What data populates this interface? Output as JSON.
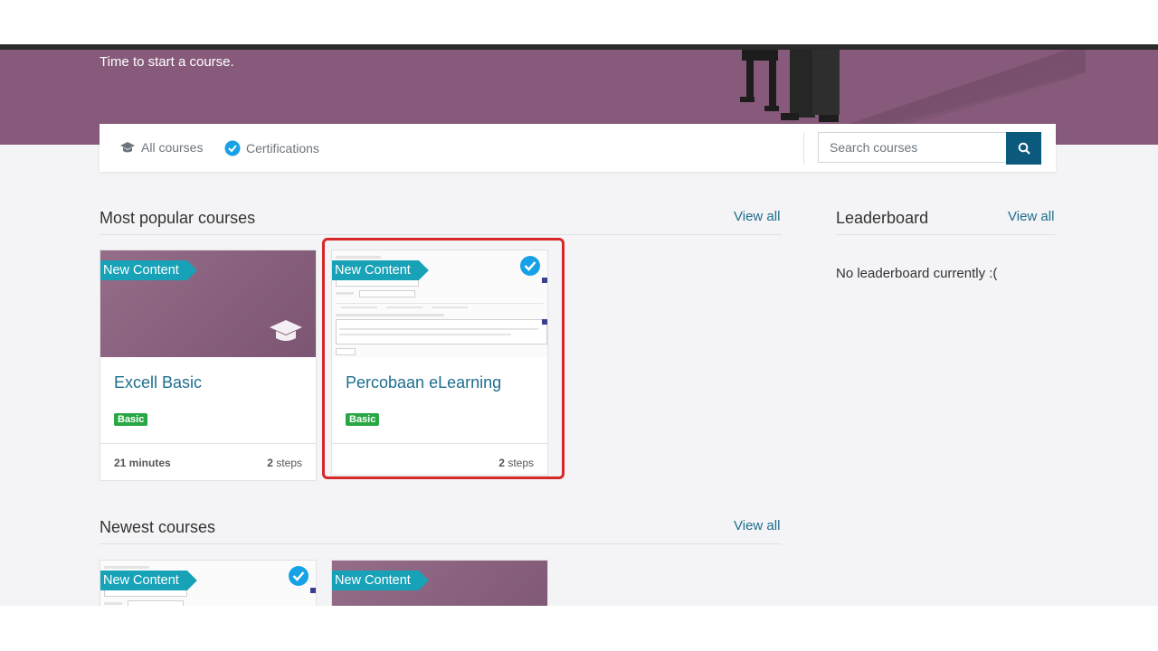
{
  "hero": {
    "subtitle": "Time to start a course."
  },
  "nav": {
    "all_courses": "All courses",
    "certifications": "Certifications",
    "search_placeholder": "Search courses"
  },
  "popular": {
    "title": "Most popular courses",
    "view_all": "View all",
    "cards": [
      {
        "ribbon": "New Content",
        "title": "Excell Basic",
        "badge": "Basic",
        "duration": "21 minutes",
        "steps_count": "2",
        "steps_label": "steps"
      },
      {
        "ribbon": "New Content",
        "title": "Percobaan eLearning",
        "badge": "Basic",
        "duration": "",
        "steps_count": "2",
        "steps_label": "steps"
      }
    ]
  },
  "leaderboard": {
    "title": "Leaderboard",
    "view_all": "View all",
    "empty_text": "No leaderboard currently :("
  },
  "newest": {
    "title": "Newest courses",
    "view_all": "View all",
    "cards": [
      {
        "ribbon": "New Content"
      },
      {
        "ribbon": "New Content"
      }
    ]
  },
  "colors": {
    "brand": "#875a7b",
    "ribbon": "#17a2b8",
    "link": "#1e6e8e",
    "badge": "#28a745",
    "search_button": "#0b5a7e",
    "highlight": "#d62828"
  },
  "icons": [
    "graduation-cap-icon",
    "certified-check-icon",
    "search-icon"
  ]
}
